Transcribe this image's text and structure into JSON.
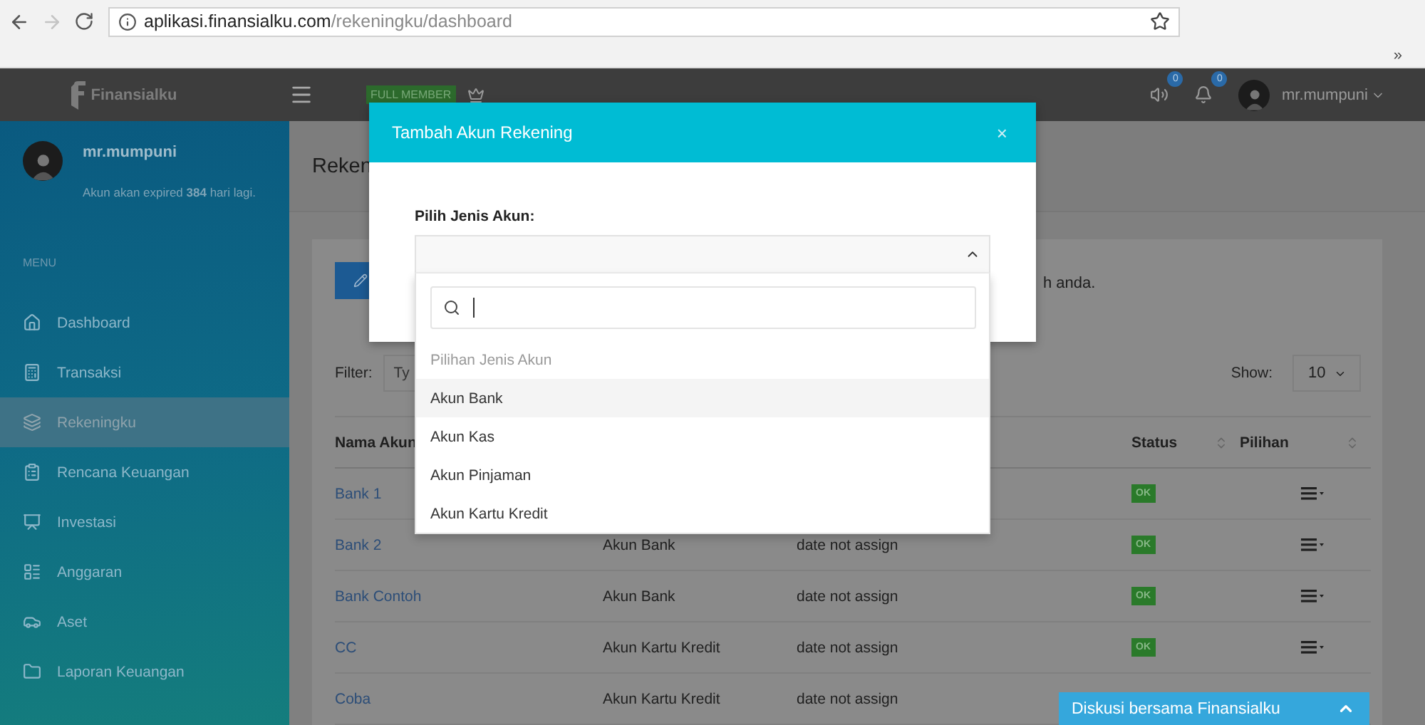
{
  "browser": {
    "url_host": "aplikasi.finansialku.com",
    "url_path": "/rekeningku/dashboard",
    "bookmarks_overflow": "»"
  },
  "header": {
    "logo": "Finansialku",
    "membership": "FULL MEMBER",
    "notifications": [
      {
        "count": "0"
      },
      {
        "count": "0"
      }
    ],
    "user": "mr.mumpuni"
  },
  "sidebar": {
    "user": "mr.mumpuni",
    "expiry": "Akun akan expired **384** hari lagi.",
    "menu_label": "MENU",
    "items": [
      {
        "label": "Dashboard",
        "selected": false
      },
      {
        "label": "Transaksi",
        "selected": false
      },
      {
        "label": "Rekeningku",
        "selected": true
      },
      {
        "label": "Rencana Keuangan",
        "selected": false
      },
      {
        "label": "Investasi",
        "selected": false
      },
      {
        "label": "Anggaran",
        "selected": false
      },
      {
        "label": "Aset",
        "selected": false
      },
      {
        "label": "Laporan Keuangan",
        "selected": false
      }
    ]
  },
  "page": {
    "title": "Reken",
    "intro_tail": "h anda.",
    "filter_label": "Filter:",
    "filter_placeholder": "Ty",
    "show_label": "Show:",
    "show_value": "10",
    "columns": [
      {
        "kind": "name",
        "label": "Nama Akun"
      },
      {
        "kind": "status",
        "label": "Status"
      },
      {
        "kind": "actions",
        "label": "Pilihan"
      }
    ],
    "rows": [
      {
        "name": "Bank 1",
        "status": "OK"
      },
      {
        "name": "Bank 2",
        "type": "Akun Bank",
        "date": "date not assign",
        "status": "OK"
      },
      {
        "name": "Bank Contoh",
        "type": "Akun Bank",
        "date": "date not assign",
        "status": "OK"
      },
      {
        "name": "CC",
        "type": "Akun Kartu Kredit",
        "date": "date not assign",
        "status": "OK"
      },
      {
        "name": "Coba",
        "type": "Akun Kartu Kredit",
        "date": "date not assign"
      }
    ]
  },
  "modal": {
    "title": "Tambah Akun Rekening",
    "close": "×",
    "field_label": "Pilih Jenis Akun:",
    "dropdown": {
      "open": true,
      "group": "Pilihan Jenis Akun",
      "options": [
        {
          "label": "Akun Bank",
          "selected": true
        },
        {
          "label": "Akun Kas",
          "selected": false
        },
        {
          "label": "Akun Pinjaman",
          "selected": false
        },
        {
          "label": "Akun Kartu Kredit",
          "selected": false
        }
      ]
    }
  },
  "chat": {
    "label": "Diskusi bersama Finansialku"
  }
}
